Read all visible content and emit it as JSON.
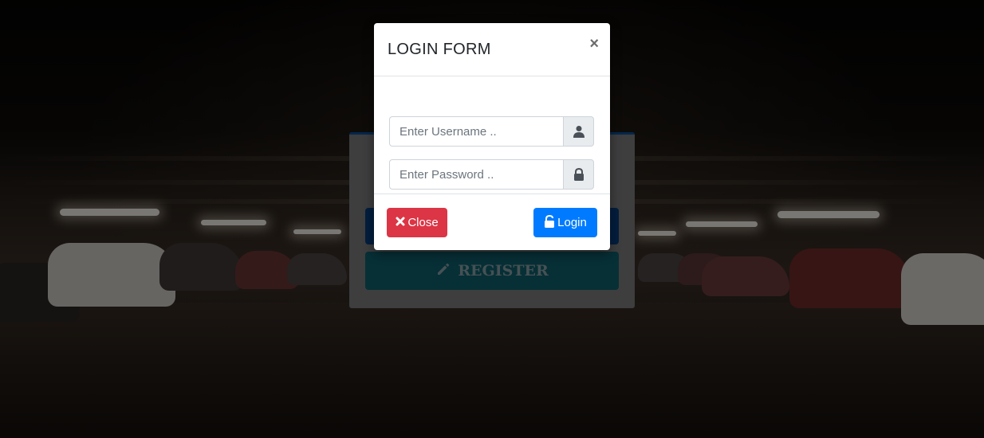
{
  "modal": {
    "title": "LOGIN FORM",
    "close_x": "×",
    "username": {
      "placeholder": "Enter Username ..",
      "value": "",
      "icon": "user-icon"
    },
    "password": {
      "placeholder": "Enter Password ..",
      "value": "",
      "icon": "lock-icon"
    },
    "close_button": {
      "label": "Close",
      "icon": "times-icon",
      "color": "#dc3545"
    },
    "login_button": {
      "label": "Login",
      "icon": "unlock-icon",
      "color": "#007bff"
    }
  },
  "background_panel": {
    "register_label": "REGISTER",
    "register_icon": "pencil-icon",
    "login_button_color": "#063d7c",
    "register_button_color": "#0f5f6d"
  }
}
